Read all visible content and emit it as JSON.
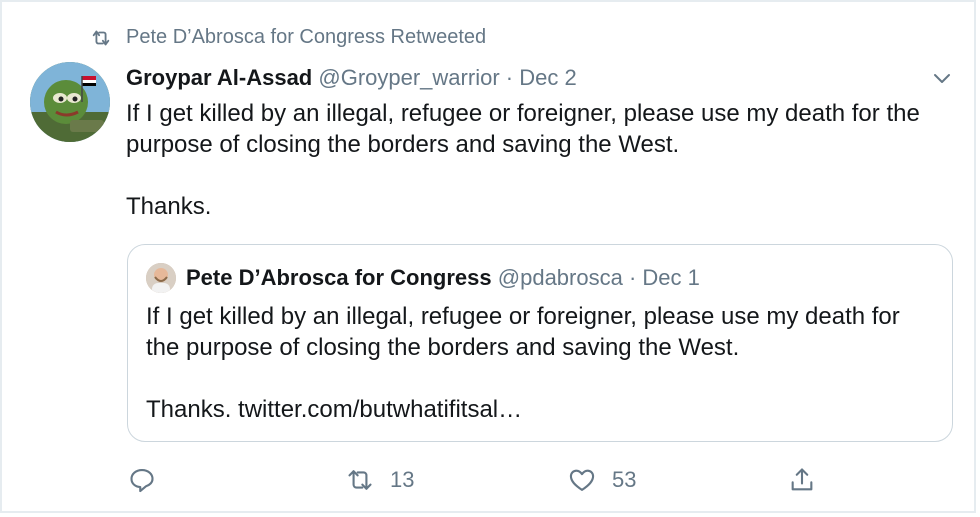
{
  "retweet_context": {
    "text": "Pete D’Abrosca for Congress Retweeted",
    "icon": "retweet-icon"
  },
  "tweet": {
    "author_name": "Groypar Al-Assad",
    "handle": "@Groyper_warrior",
    "separator": "·",
    "date": "Dec 2",
    "paragraphs": [
      "If I get killed by an illegal, refugee or foreigner, please use my death for the purpose of closing the borders and saving the West.",
      "Thanks."
    ]
  },
  "quoted_tweet": {
    "author_name": "Pete D’Abrosca for Congress",
    "handle": "@pdabrosca",
    "separator": "·",
    "date": "Dec 1",
    "paragraphs": [
      "If I get killed by an illegal, refugee or foreigner, please use my death for the purpose of closing the borders and saving the West.",
      "Thanks. twitter.com/butwhatifitsal…"
    ]
  },
  "actions": {
    "reply_icon": "reply-icon",
    "retweet_icon": "retweet-icon",
    "retweet_count": "13",
    "like_icon": "heart-icon",
    "like_count": "53",
    "share_icon": "share-icon"
  },
  "colors": {
    "text_primary": "#14171a",
    "text_secondary": "#657786",
    "border": "#e6ecf0",
    "quote_border": "#ccd6dd"
  }
}
